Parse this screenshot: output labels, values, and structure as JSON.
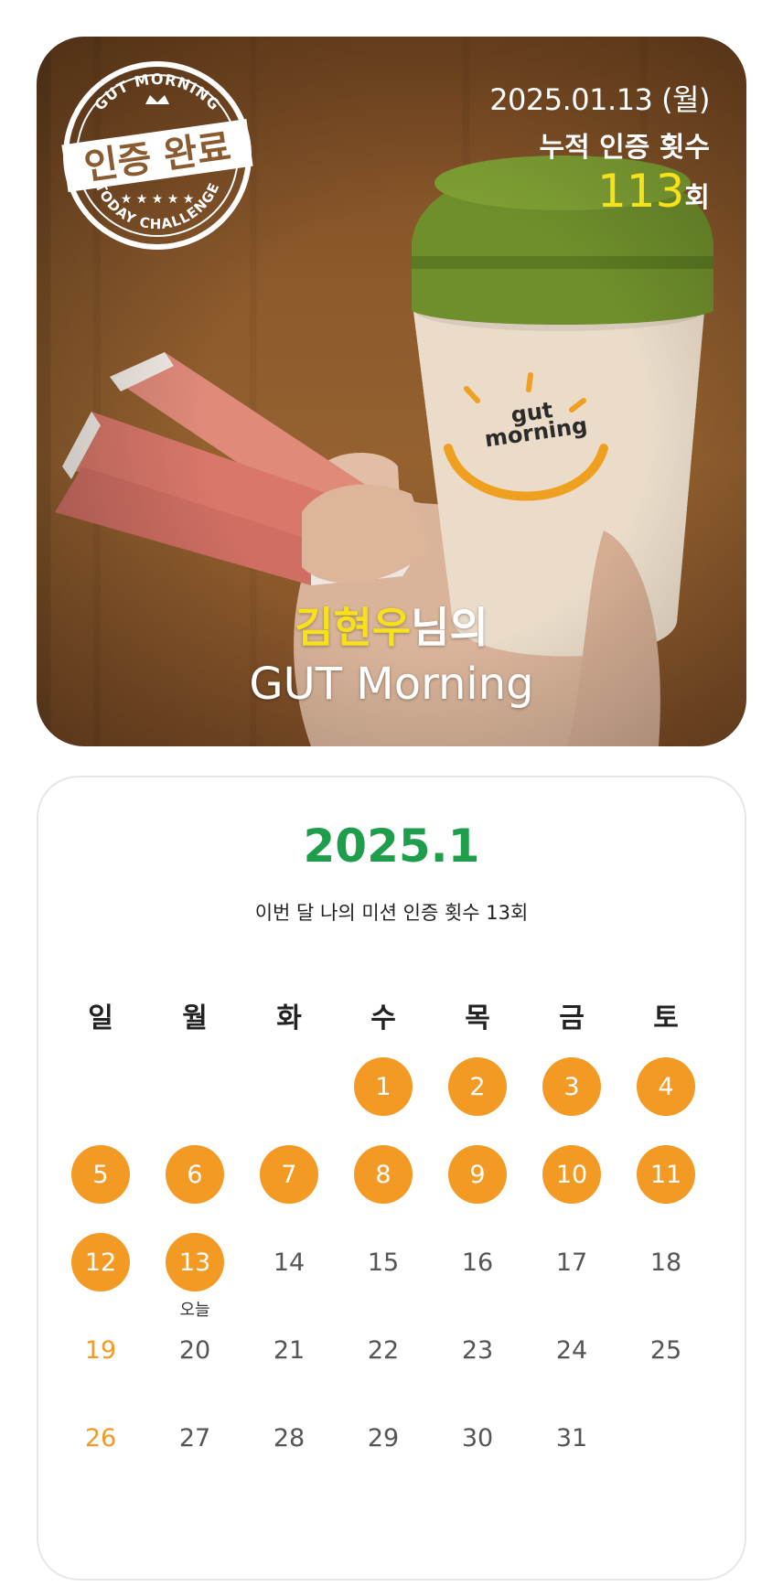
{
  "header": {
    "date": "2025.01.13 (월)",
    "cumulative_label": "누적 인증 횟수",
    "cumulative_count": "113",
    "cumulative_unit": "회",
    "stamp": {
      "top_text": "GUT MORNING",
      "main_text": "인증 완료",
      "bottom_text": "TODAY CHALLENGE"
    },
    "owner_name": "김현우",
    "owner_suffix": "님의",
    "title": "GUT Morning",
    "product_logo": "gut morning"
  },
  "calendar": {
    "title": "2025.1",
    "subtitle": "이번 달 나의 미션 인증 횟수 13회",
    "weekdays": [
      "일",
      "월",
      "화",
      "수",
      "목",
      "금",
      "토"
    ],
    "today_label": "오늘",
    "accent_color": "#f39a24",
    "title_color": "#1e9e4a",
    "weeks": [
      [
        null,
        null,
        null,
        {
          "d": "1",
          "done": true
        },
        {
          "d": "2",
          "done": true
        },
        {
          "d": "3",
          "done": true
        },
        {
          "d": "4",
          "done": true
        }
      ],
      [
        {
          "d": "5",
          "done": true
        },
        {
          "d": "6",
          "done": true
        },
        {
          "d": "7",
          "done": true
        },
        {
          "d": "8",
          "done": true
        },
        {
          "d": "9",
          "done": true
        },
        {
          "d": "10",
          "done": true
        },
        {
          "d": "11",
          "done": true
        }
      ],
      [
        {
          "d": "12",
          "done": true
        },
        {
          "d": "13",
          "done": true,
          "today": true
        },
        {
          "d": "14"
        },
        {
          "d": "15"
        },
        {
          "d": "16"
        },
        {
          "d": "17"
        },
        {
          "d": "18"
        }
      ],
      [
        {
          "d": "19"
        },
        {
          "d": "20"
        },
        {
          "d": "21"
        },
        {
          "d": "22"
        },
        {
          "d": "23"
        },
        {
          "d": "24"
        },
        {
          "d": "25"
        }
      ],
      [
        {
          "d": "26"
        },
        {
          "d": "27"
        },
        {
          "d": "28"
        },
        {
          "d": "29"
        },
        {
          "d": "30"
        },
        {
          "d": "31"
        },
        null
      ]
    ]
  }
}
